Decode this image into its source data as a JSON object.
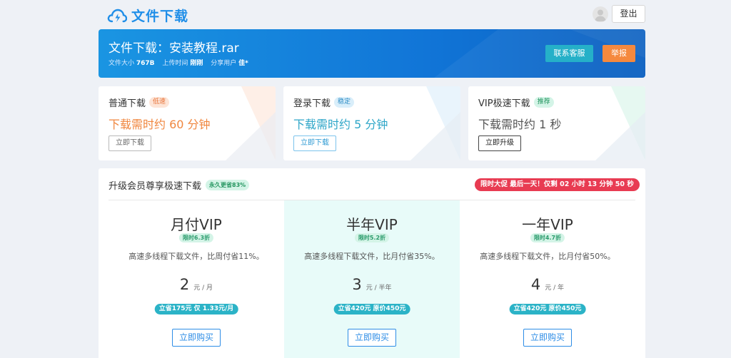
{
  "header": {
    "logo_text": "文件下载",
    "logout_label": "登出"
  },
  "hero": {
    "title": "文件下载：安装教程.rar",
    "size_label": "文件大小",
    "size_value": "767B",
    "upload_label": "上传时间",
    "upload_value": "刚刚",
    "share_label": "分享用户",
    "share_value": "佳*",
    "service_label": "联系客服",
    "report_label": "举报"
  },
  "download_options": [
    {
      "title": "普通下载",
      "tag": "低速",
      "time": "下载需时约 60 分钟",
      "button": "立即下载"
    },
    {
      "title": "登录下载",
      "tag": "稳定",
      "time": "下载需时约 5 分钟",
      "button": "立即下载"
    },
    {
      "title": "VIP极速下载",
      "tag": "推荐",
      "time": "下载需时约 1 秒",
      "button": "立即升级"
    }
  ],
  "vip": {
    "heading": "升级会员尊享极速下载",
    "heading_badge": "永久更省83%",
    "promo": "限时大促 最后一天！仅剩 02 小时 13 分钟 50 秒",
    "plans": [
      {
        "name": "月付VIP",
        "badge": "限时6.3折",
        "desc": "高速多线程下载文件，比周付省11%。",
        "price": "2",
        "unit": "元 / 月",
        "save": "立省175元 仅 1.33元/月",
        "button": "立即购买"
      },
      {
        "name": "半年VIP",
        "badge": "限时5.2折",
        "desc": "高速多线程下载文件，比月付省35%。",
        "price": "3",
        "unit": "元 / 半年",
        "save": "立省420元 原价450元",
        "button": "立即购买"
      },
      {
        "name": "一年VIP",
        "badge": "限时4.7折",
        "desc": "高速多线程下载文件，比月付省50%。",
        "price": "4",
        "unit": "元 / 年",
        "save": "立省420元 原价450元",
        "button": "立即购买"
      }
    ]
  },
  "colors": {
    "brand_blue": "#1f8ee8",
    "orange": "#f5893e",
    "teal": "#2bb3c7",
    "promo_red": "#e83b52",
    "featured_plan_bg": "#e8fbf9"
  }
}
